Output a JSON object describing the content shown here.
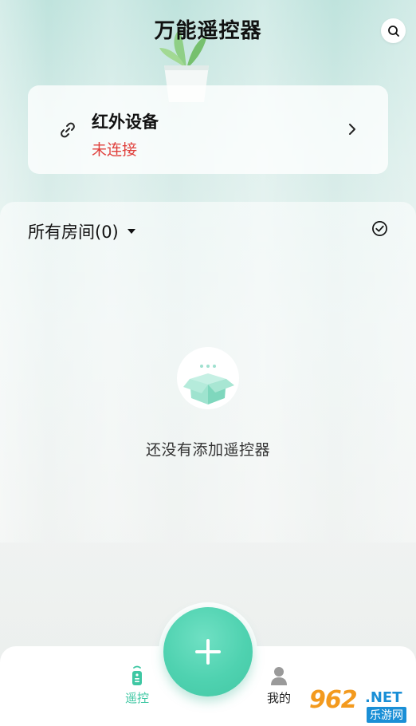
{
  "header": {
    "title": "万能遥控器"
  },
  "device_card": {
    "name": "红外设备",
    "status": "未连接"
  },
  "rooms": {
    "filter_label": "所有房间(0)"
  },
  "empty_state": {
    "message": "还没有添加遥控器"
  },
  "tabbar": {
    "remote_label": "遥控",
    "mine_label": "我的"
  },
  "watermark": {
    "brand": "962",
    "net": ".NET",
    "sub": "乐游网"
  },
  "colors": {
    "accent": "#4fd2b0",
    "status_error": "#e0413d",
    "active_tab": "#3ec7a3"
  },
  "icons": {
    "search": "search-icon",
    "link": "link-icon",
    "chevron": "chevron-right-icon",
    "dropdown": "caret-down-icon",
    "select": "check-circle-icon",
    "empty": "empty-box-icon",
    "remote_tab": "remote-icon",
    "mine_tab": "user-icon",
    "add": "plus-icon"
  }
}
